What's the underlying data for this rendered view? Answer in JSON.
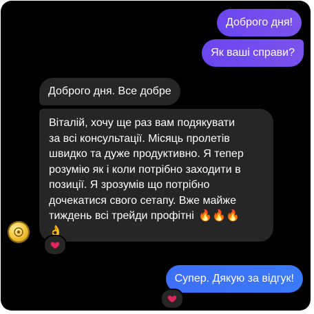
{
  "conversation": {
    "messages": [
      {
        "sender": "me",
        "text": "Доброго дня!"
      },
      {
        "sender": "me",
        "text": "Як ваші справи?"
      },
      {
        "sender": "contact",
        "text": "Доброго дня. Все добре"
      },
      {
        "sender": "contact",
        "lines": [
          "Віталій, хочу ще раз вам подякувати",
          "за всі консультації. Місяць пролетів",
          "швидко та дуже продуктивно. Я тепер",
          "розумію як і коли потрібно заходити в",
          "позиції. Я зрозумів що потрібно",
          "дочекатися свого сетапу. Вже майже",
          "тиждень всі трейди профітні"
        ],
        "emoji_trail": "🔥🔥🔥",
        "emoji_line": "👌",
        "reaction": "❤️"
      },
      {
        "sender": "me",
        "text": "Супер. Дякую за відгук!",
        "reaction": "❤️"
      }
    ]
  },
  "colors": {
    "background": "#000000",
    "outgoing_purple": "#7050ef",
    "outgoing_blue": "#3c74f5",
    "incoming": "#262626",
    "reaction_heart": "#e0245e"
  },
  "icons": {
    "contact_avatar": "gold-coin-avatar",
    "reaction": "heart-icon"
  }
}
